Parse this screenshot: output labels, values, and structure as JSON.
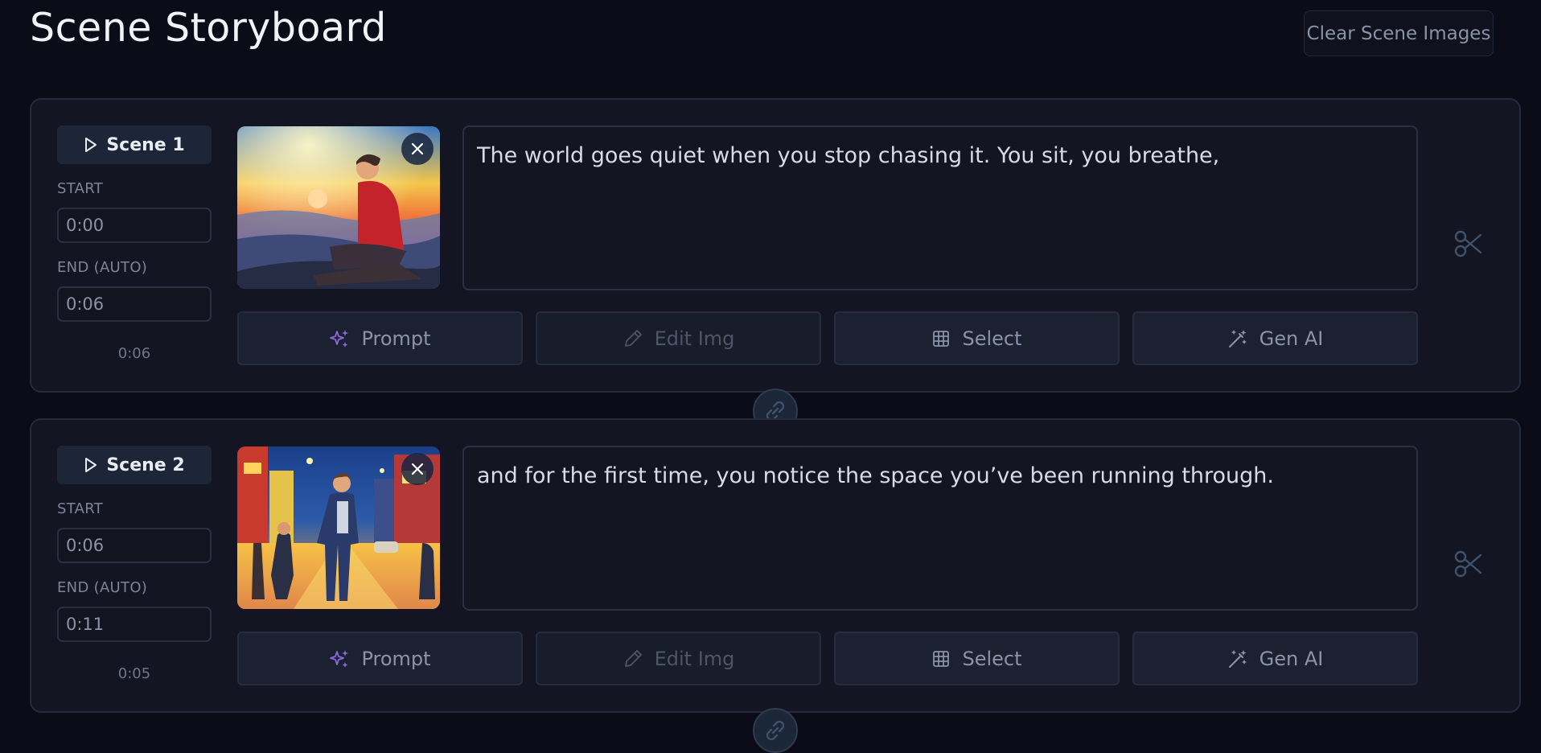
{
  "header": {
    "title": "Scene Storyboard",
    "clear_button": "Clear Scene Images"
  },
  "labels": {
    "start": "START",
    "end": "END (AUTO)"
  },
  "buttons": {
    "prompt": "Prompt",
    "edit": "Edit Img",
    "select": "Select",
    "gen": "Gen AI"
  },
  "scenes": [
    {
      "label": "Scene 1",
      "start": "0:00",
      "end": "0:06",
      "duration": "0:06",
      "narration": "The world goes quiet when you stop chasing it. You sit, you breathe,"
    },
    {
      "label": "Scene 2",
      "start": "0:06",
      "end": "0:11",
      "duration": "0:05",
      "narration": "and for the first time, you notice the space you’ve been running through."
    }
  ],
  "icons": {
    "play": "play-icon",
    "close": "close-icon",
    "sparkles": "sparkles-icon",
    "pencil": "pencil-icon",
    "grid": "grid-icon",
    "wand": "magic-wand-icon",
    "scissors": "scissors-icon",
    "link": "link-icon"
  },
  "colors": {
    "background": "#0b0c17",
    "card": "#141522",
    "accent_purple": "#8a6ad6"
  }
}
